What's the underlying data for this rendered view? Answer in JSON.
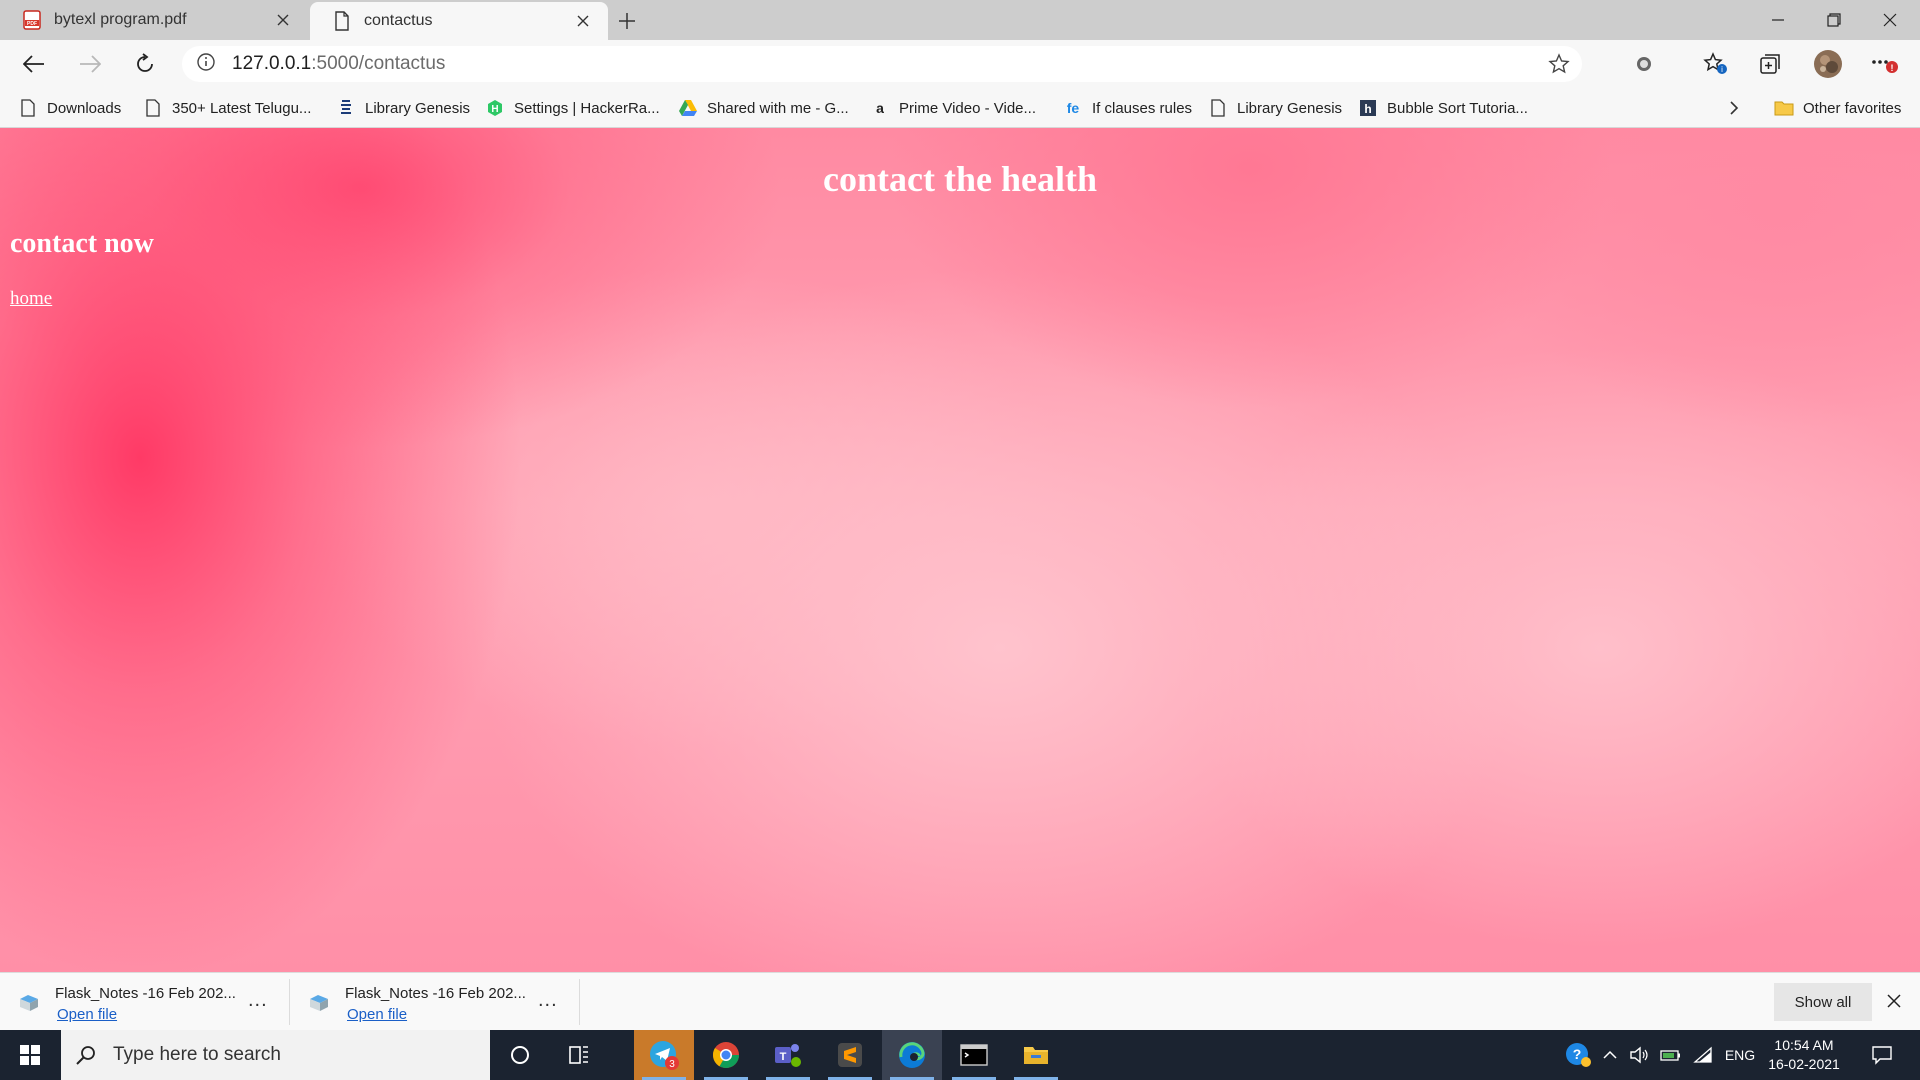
{
  "browser": {
    "tabs": [
      {
        "title": "bytexl program.pdf",
        "icon": "pdf-icon"
      },
      {
        "title": "contactus",
        "icon": "page-icon"
      }
    ],
    "address": {
      "host": "127.0.0.1",
      "path": ":5000/contactus"
    },
    "bookmarks": [
      {
        "label": "Downloads",
        "icon": "page-icon"
      },
      {
        "label": "350+ Latest Telugu...",
        "icon": "page-icon"
      },
      {
        "label": "Library Genesis",
        "icon": "libgen-icon"
      },
      {
        "label": "Settings | HackerRa...",
        "icon": "hackerrank-icon"
      },
      {
        "label": "Shared with me - G...",
        "icon": "google-drive-icon"
      },
      {
        "label": "Prime Video - Vide...",
        "icon": "amazon-icon"
      },
      {
        "label": "If clauses rules",
        "icon": "fe-icon"
      },
      {
        "label": "Library Genesis",
        "icon": "page-icon"
      },
      {
        "label": "Bubble Sort Tutoria...",
        "icon": "h-icon"
      }
    ],
    "other_favorites": "Other favorites"
  },
  "page": {
    "title": "contact the health",
    "heading": "contact now",
    "link": "home"
  },
  "downloads": {
    "items": [
      {
        "name": "Flask_Notes -16 Feb 202...",
        "action": "Open file"
      },
      {
        "name": "Flask_Notes -16 Feb 202...",
        "action": "Open file"
      }
    ],
    "show_all": "Show all",
    "more": "..."
  },
  "taskbar": {
    "search_placeholder": "Type here to search",
    "telegram_badge": "3",
    "language": "ENG",
    "time": "10:54 AM",
    "date": "16-02-2021"
  },
  "colors": {
    "accent_link": "#1a5fc7",
    "page_pink": "#ff8aa2",
    "taskbar": "#1b2330"
  }
}
